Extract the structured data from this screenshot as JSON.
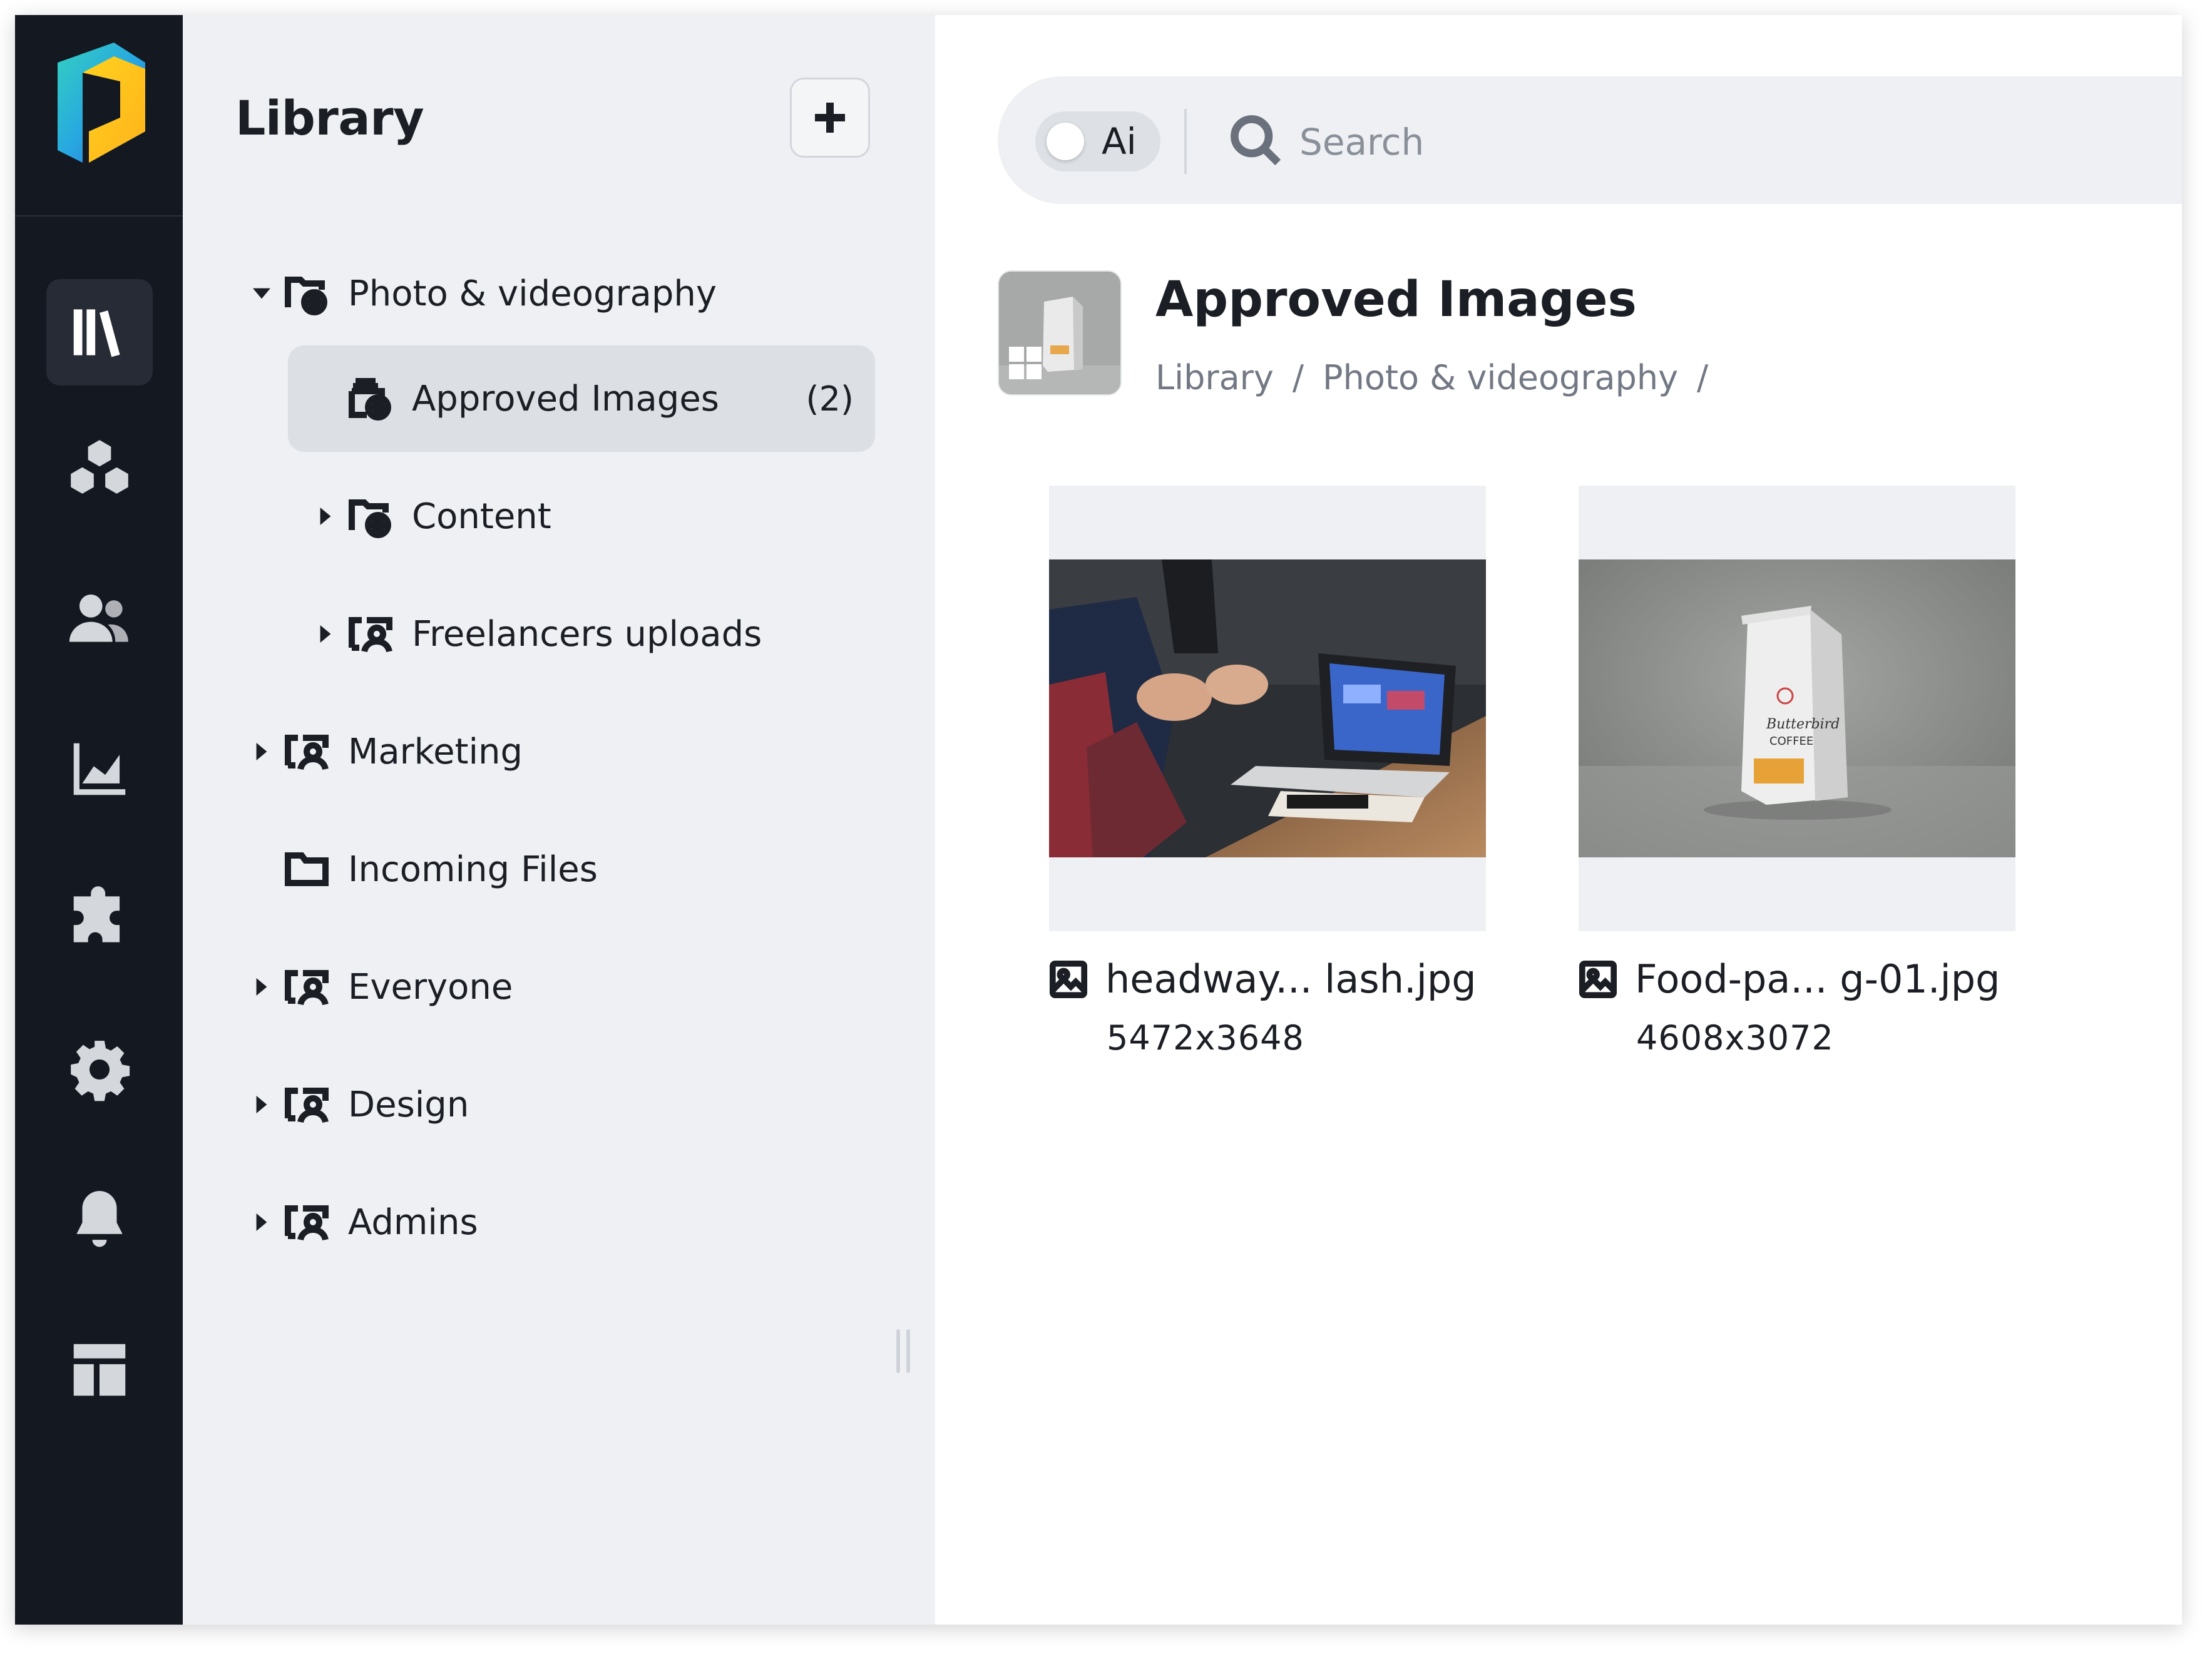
{
  "rail": {
    "items": [
      {
        "name": "library-icon",
        "active": true
      },
      {
        "name": "assets-icon",
        "active": false
      },
      {
        "name": "users-icon",
        "active": false
      },
      {
        "name": "analytics-icon",
        "active": false
      },
      {
        "name": "integrations-icon",
        "active": false
      },
      {
        "name": "settings-icon",
        "active": false
      },
      {
        "name": "notifications-icon",
        "active": false
      },
      {
        "name": "layout-icon",
        "active": false
      }
    ]
  },
  "library": {
    "title": "Library",
    "add_label": "+",
    "tree": [
      {
        "label": "Photo & videography",
        "icon": "folder-globe-icon",
        "expanded": true
      },
      {
        "label": "Approved Images",
        "icon": "collection-globe-icon",
        "count": "(2)",
        "selected": true
      },
      {
        "label": "Content",
        "icon": "folder-globe-icon"
      },
      {
        "label": "Freelancers uploads",
        "icon": "folder-user-icon"
      },
      {
        "label": "Marketing",
        "icon": "folder-user-icon"
      },
      {
        "label": "Incoming Files",
        "icon": "folder-icon"
      },
      {
        "label": "Everyone",
        "icon": "folder-user-icon"
      },
      {
        "label": "Design",
        "icon": "folder-user-icon"
      },
      {
        "label": "Admins",
        "icon": "folder-user-icon"
      }
    ]
  },
  "search": {
    "ai_label": "Ai",
    "placeholder": "Search"
  },
  "folder": {
    "title": "Approved Images",
    "breadcrumb": [
      "Library",
      "/",
      "Photo & videography",
      "/"
    ]
  },
  "assets": [
    {
      "name": "headway... lash.jpg",
      "dimensions": "5472x3648"
    },
    {
      "name": "Food-pa... g-01.jpg",
      "dimensions": "4608x3072"
    }
  ],
  "colors": {
    "rail_bg": "#141821",
    "panel_bg": "#eef0f3",
    "selected_bg": "#dcdfe4"
  }
}
